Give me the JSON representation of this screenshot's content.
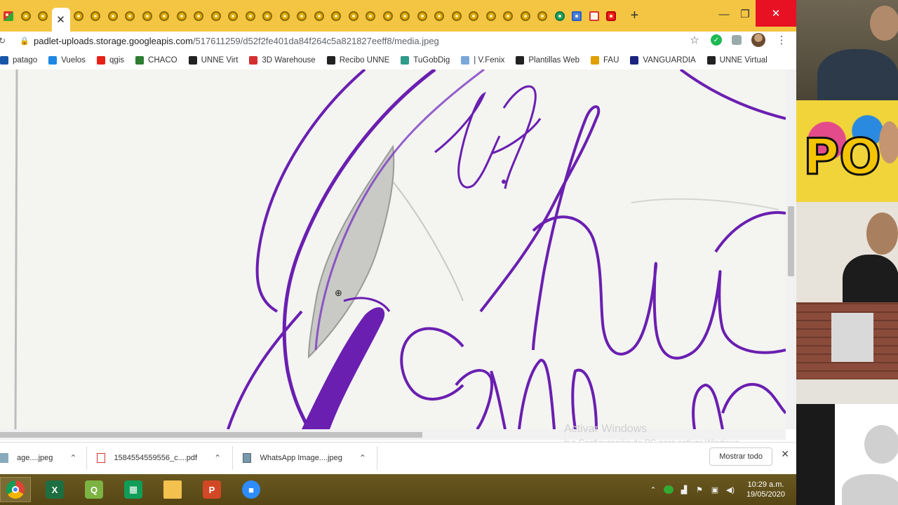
{
  "browser": {
    "tabs": {
      "active_close_label": "✕",
      "new_tab_label": "+"
    },
    "window_controls": {
      "minimize": "—",
      "maximize": "❐",
      "close": "✕"
    },
    "address": {
      "host": "padlet-uploads.storage.googleapis.com",
      "path": "/517611259/d52f2fe401da84f264c5a821827eeff8/media.jpeg"
    },
    "bookmarks": [
      {
        "label": "patago",
        "icon": "bp-icon",
        "color": "#1a56a8"
      },
      {
        "label": "Vuelos",
        "icon": "plane-icon",
        "color": "#1e88e5"
      },
      {
        "label": "qgis",
        "icon": "youtube-icon",
        "color": "#e62117"
      },
      {
        "label": "CHACO",
        "icon": "chaco-icon",
        "color": "#2e7d32"
      },
      {
        "label": "UNNE Virt",
        "icon": "shield-icon",
        "color": "#222222"
      },
      {
        "label": "3D Warehouse",
        "icon": "warehouse-icon",
        "color": "#d32f2f"
      },
      {
        "label": "Recibo UNNE",
        "icon": "shield-icon",
        "color": "#222222"
      },
      {
        "label": "TuGobDig",
        "icon": "leaf-icon",
        "color": "#2e9c8a"
      },
      {
        "label": "| V.Fenix",
        "icon": "vf-icon",
        "color": "#7aa7d8"
      },
      {
        "label": "Plantillas Web",
        "icon": "wix-icon",
        "color": "#222222"
      },
      {
        "label": "FAU",
        "icon": "fau-icon",
        "color": "#e0a000"
      },
      {
        "label": "VANGUARDIA",
        "icon": "van-icon",
        "color": "#1a237e"
      },
      {
        "label": "UNNE Virtual",
        "icon": "shield-icon",
        "color": "#222222"
      }
    ],
    "watermark": {
      "line1": "Activar Windows",
      "line2": "Ir a Configuración de PC para activar Windows."
    },
    "downloads": {
      "items": [
        {
          "label": "age....jpeg",
          "icon": "image-file-icon"
        },
        {
          "label": "1584554559556_c....pdf",
          "icon": "pdf-file-icon"
        },
        {
          "label": "WhatsApp Image....jpeg",
          "icon": "image-file-icon"
        }
      ],
      "show_all": "Mostrar todo",
      "close": "✕"
    }
  },
  "taskbar": {
    "apps": [
      {
        "name": "chrome-icon",
        "color": "#db4437"
      },
      {
        "name": "excel-icon",
        "color": "#1d6f42",
        "text": "X"
      },
      {
        "name": "qgis-icon",
        "color": "#7cb342",
        "text": "Q"
      },
      {
        "name": "sheets-icon",
        "color": "#0f9d58",
        "text": "▦"
      },
      {
        "name": "file-explorer-icon",
        "color": "#f2c14e",
        "text": ""
      },
      {
        "name": "powerpoint-icon",
        "color": "#d24726",
        "text": "P"
      },
      {
        "name": "zoom-icon",
        "color": "#2d8cff",
        "text": "■"
      }
    ],
    "clock": {
      "time": "10:29 a.m.",
      "date": "19/05/2020"
    }
  },
  "colors": {
    "tabstrip": "#f4c542",
    "ink_purple": "#6a1fb0",
    "paper": "#f4f4f1",
    "close_red": "#e81123"
  }
}
